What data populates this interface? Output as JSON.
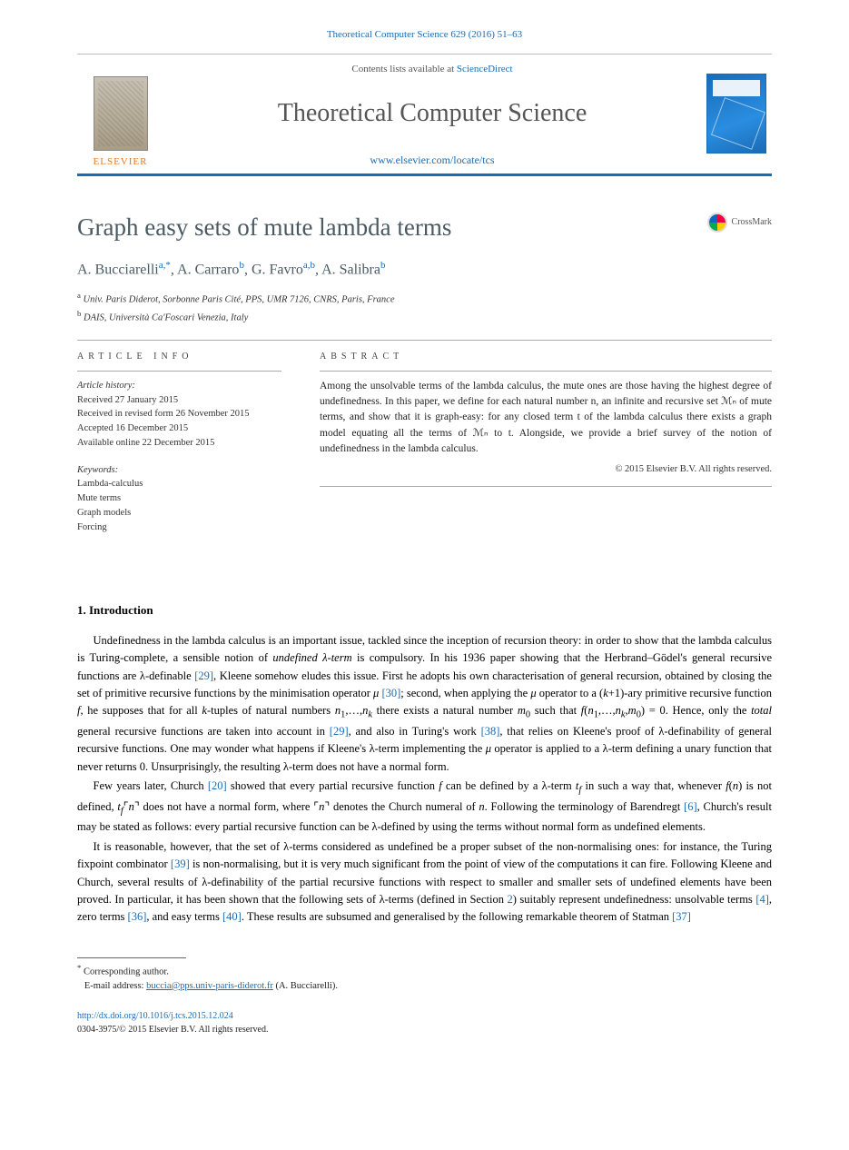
{
  "citation": "Theoretical Computer Science 629 (2016) 51–63",
  "publisher": {
    "name": "ELSEVIER",
    "lists_text": "Contents lists available at ",
    "lists_link_text": "ScienceDirect",
    "journal_name": "Theoretical Computer Science",
    "journal_link": "www.elsevier.com/locate/tcs"
  },
  "crossmark_label": "CrossMark",
  "article": {
    "title": "Graph easy sets of mute lambda terms",
    "authors_html": "A. Bucciarelli ",
    "authors": [
      {
        "name": "A. Bucciarelli",
        "aff": "a,",
        "mark": "*"
      },
      {
        "name": "A. Carraro",
        "aff": "b",
        "mark": ""
      },
      {
        "name": "G. Favro",
        "aff": "a,b",
        "mark": ""
      },
      {
        "name": "A. Salibra",
        "aff": "b",
        "mark": ""
      }
    ],
    "affiliations": {
      "a": "Univ. Paris Diderot, Sorbonne Paris Cité, PPS, UMR 7126, CNRS, Paris, France",
      "b": "DAIS, Università Ca'Foscari Venezia, Italy"
    }
  },
  "article_info": {
    "heading": "ARTICLE INFO",
    "history_label": "Article history:",
    "history": [
      "Received 27 January 2015",
      "Received in revised form 26 November 2015",
      "Accepted 16 December 2015",
      "Available online 22 December 2015"
    ],
    "keywords_label": "Keywords:",
    "keywords": [
      "Lambda-calculus",
      "Mute terms",
      "Graph models",
      "Forcing"
    ]
  },
  "abstract": {
    "heading": "ABSTRACT",
    "text": "Among the unsolvable terms of the lambda calculus, the mute ones are those having the highest degree of undefinedness. In this paper, we define for each natural number n, an infinite and recursive set ℳₙ of mute terms, and show that it is graph-easy: for any closed term t of the lambda calculus there exists a graph model equating all the terms of ℳₙ to t. Alongside, we provide a brief survey of the notion of undefinedness in the lambda calculus.",
    "copyright": "© 2015 Elsevier B.V. All rights reserved."
  },
  "section1": {
    "heading": "1. Introduction",
    "p1": "Undefinedness in the lambda calculus is an important issue, tackled since the inception of recursion theory: in order to show that the lambda calculus is Turing-complete, a sensible notion of undefined λ-term is compulsory. In his 1936 paper showing that the Herbrand–Gödel's general recursive functions are λ-definable [29], Kleene somehow eludes this issue. First he adopts his own characterisation of general recursion, obtained by closing the set of primitive recursive functions by the minimisation operator μ [30]; second, when applying the μ operator to a (k+1)-ary primitive recursive function f, he supposes that for all k-tuples of natural numbers n₁,…,nₖ there exists a natural number m₀ such that f(n₁,…,nₖ,m₀) = 0. Hence, only the total general recursive functions are taken into account in [29], and also in Turing's work [38], that relies on Kleene's proof of λ-definability of general recursive functions. One may wonder what happens if Kleene's λ-term implementing the μ operator is applied to a λ-term defining a unary function that never returns 0. Unsurprisingly, the resulting λ-term does not have a normal form.",
    "p2": "Few years later, Church [20] showed that every partial recursive function f can be defined by a λ-term t_f in such a way that, whenever f(n) is not defined, t_f⌜n⌝ does not have a normal form, where ⌜n⌝ denotes the Church numeral of n. Following the terminology of Barendregt [6], Church's result may be stated as follows: every partial recursive function can be λ-defined by using the terms without normal form as undefined elements.",
    "p3": "It is reasonable, however, that the set of λ-terms considered as undefined be a proper subset of the non-normalising ones: for instance, the Turing fixpoint combinator [39] is non-normalising, but it is very much significant from the point of view of the computations it can fire. Following Kleene and Church, several results of λ-definability of the partial recursive functions with respect to smaller and smaller sets of undefined elements have been proved. In particular, it has been shown that the following sets of λ-terms (defined in Section 2) suitably represent undefinedness: unsolvable terms [4], zero terms [36], and easy terms [40]. These results are subsumed and generalised by the following remarkable theorem of Statman [37]"
  },
  "footnotes": {
    "corresponding": "Corresponding author.",
    "email_label": "E-mail address:",
    "email": "buccia@pps.univ-paris-diderot.fr",
    "email_person": "(A. Bucciarelli)."
  },
  "footer": {
    "doi": "http://dx.doi.org/10.1016/j.tcs.2015.12.024",
    "issn_line": "0304-3975/© 2015 Elsevier B.V. All rights reserved."
  }
}
